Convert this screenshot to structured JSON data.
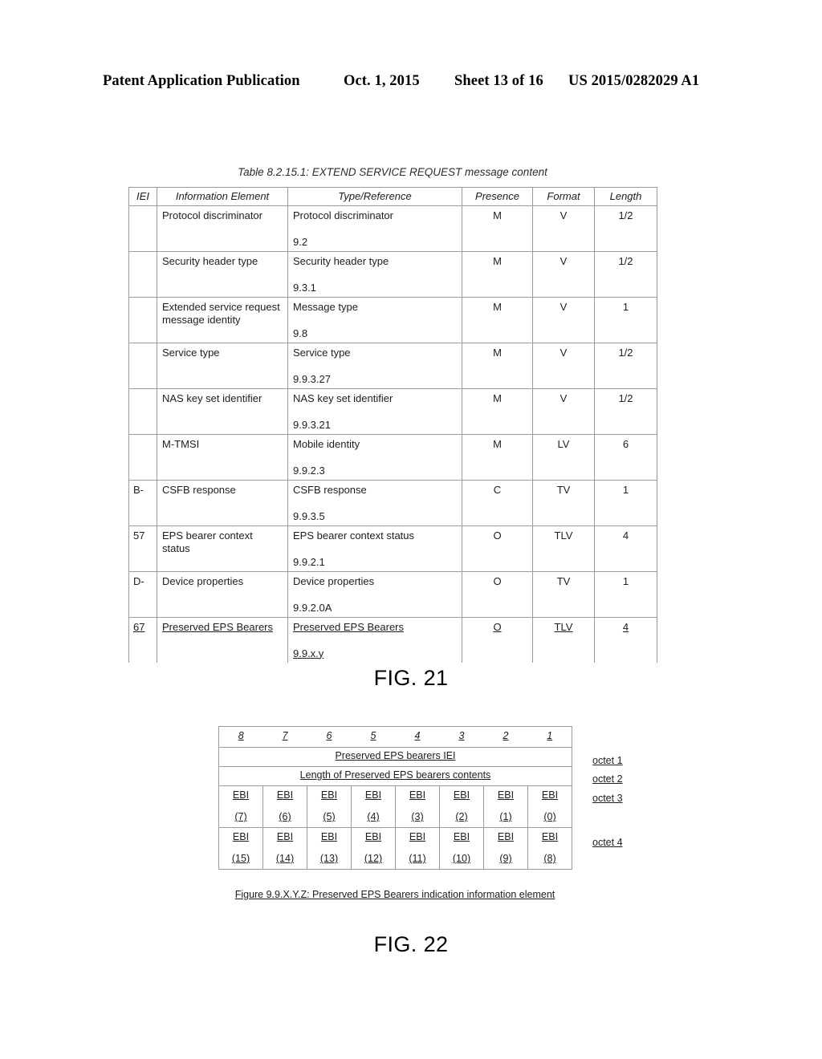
{
  "page_header": {
    "publication": "Patent Application Publication",
    "date": "Oct. 1, 2015",
    "sheet": "Sheet 13 of 16",
    "patent_number": "US 2015/0282029 A1"
  },
  "figure21": {
    "label": "FIG. 21",
    "table_title": "Table 8.2.15.1: EXTEND SERVICE REQUEST message content",
    "columns": [
      "IEI",
      "Information Element",
      "Type/Reference",
      "Presence",
      "Format",
      "Length"
    ],
    "rows": [
      {
        "iei": "",
        "ie": "Protocol discriminator",
        "ie2": "",
        "type": "Protocol discriminator",
        "ref": "9.2",
        "presence": "M",
        "format": "V",
        "length": "1/2",
        "underline": false
      },
      {
        "iei": "",
        "ie": "Security header type",
        "ie2": "",
        "type": "Security header type",
        "ref": "9.3.1",
        "presence": "M",
        "format": "V",
        "length": "1/2",
        "underline": false
      },
      {
        "iei": "",
        "ie": "Extended service request",
        "ie2": "message identity",
        "type": "Message type",
        "ref": "9.8",
        "presence": "M",
        "format": "V",
        "length": "1",
        "underline": false
      },
      {
        "iei": "",
        "ie": "Service type",
        "ie2": "",
        "type": "Service type",
        "ref": "9.9.3.27",
        "presence": "M",
        "format": "V",
        "length": "1/2",
        "underline": false
      },
      {
        "iei": "",
        "ie": "NAS key set identifier",
        "ie2": "",
        "type": "NAS key set identifier",
        "ref": "9.9.3.21",
        "presence": "M",
        "format": "V",
        "length": "1/2",
        "underline": false
      },
      {
        "iei": "",
        "ie": "M-TMSI",
        "ie2": "",
        "type": "Mobile identity",
        "ref": "9.9.2.3",
        "presence": "M",
        "format": "LV",
        "length": "6",
        "underline": false
      },
      {
        "iei": "B-",
        "ie": "CSFB response",
        "ie2": "",
        "type": "CSFB response",
        "ref": "9.9.3.5",
        "presence": "C",
        "format": "TV",
        "length": "1",
        "underline": false
      },
      {
        "iei": "57",
        "ie": "EPS bearer context",
        "ie2": "status",
        "type": "EPS bearer context status",
        "ref": "9.9.2.1",
        "presence": "O",
        "format": "TLV",
        "length": "4",
        "underline": false
      },
      {
        "iei": "D-",
        "ie": "Device properties",
        "ie2": "",
        "type": "Device properties",
        "ref": "9.9.2.0A",
        "presence": "O",
        "format": "TV",
        "length": "1",
        "underline": false
      },
      {
        "iei": "67",
        "ie": "Preserved EPS Bearers",
        "ie2": "",
        "type": "Preserved EPS Bearers",
        "ref": "9.9.x.y",
        "presence": "O",
        "format": "TLV",
        "length": "4",
        "underline": true
      }
    ]
  },
  "figure22": {
    "label": "FIG. 22",
    "bit_numbers": [
      "8",
      "7",
      "6",
      "5",
      "4",
      "3",
      "2",
      "1"
    ],
    "iei_row": "Preserved EPS bearers IEI",
    "length_row": "Length of Preserved EPS bearers contents",
    "ebi_label": "EBI",
    "ebi_row_1": [
      "(7)",
      "(6)",
      "(5)",
      "(4)",
      "(3)",
      "(2)",
      "(1)",
      "(0)"
    ],
    "ebi_row_2": [
      "(15)",
      "(14)",
      "(13)",
      "(12)",
      "(11)",
      "(10)",
      "(9)",
      "(8)"
    ],
    "octets": [
      "octet 1",
      "octet 2",
      "octet 3",
      "octet 4"
    ],
    "caption": "Figure 9.9.X.Y.Z: Preserved EPS Bearers indication information element"
  }
}
